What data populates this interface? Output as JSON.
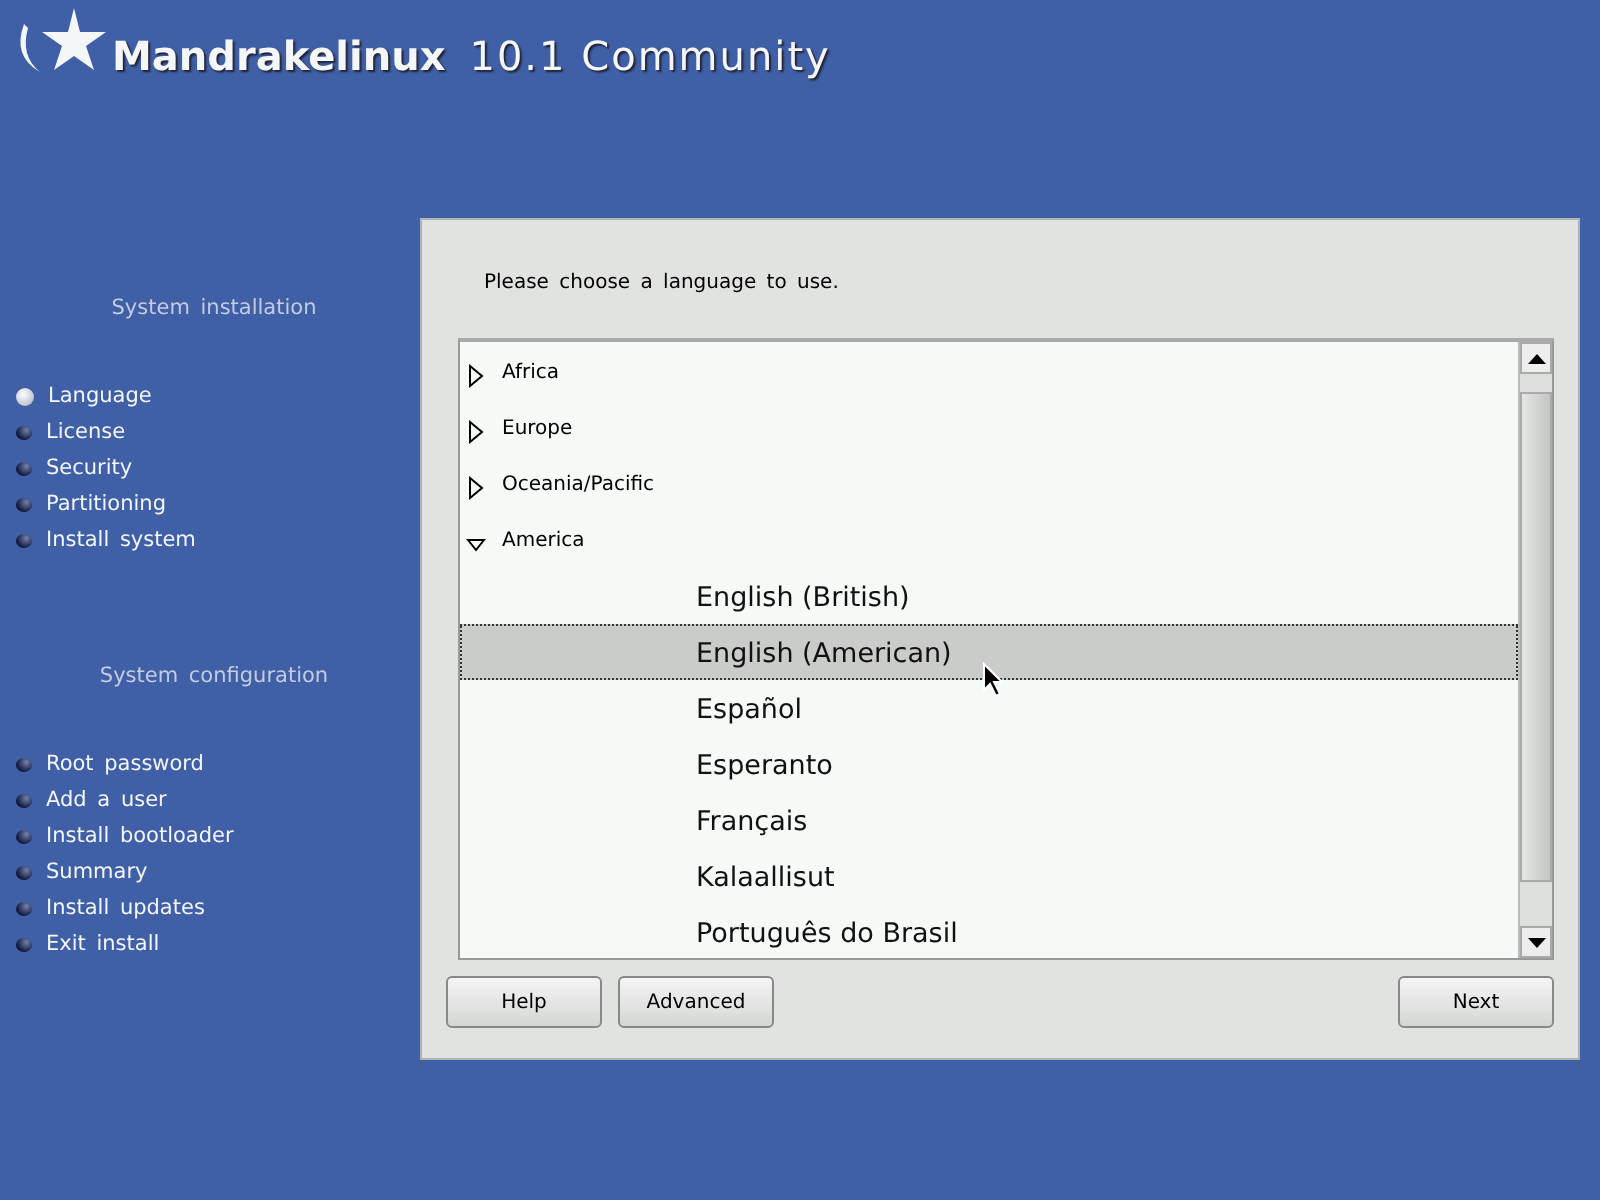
{
  "header": {
    "brand": "Mandrakelinux",
    "version": "10.1 Community"
  },
  "sidebar": {
    "sections": [
      {
        "title": "System installation",
        "items": [
          {
            "label": "Language",
            "selected": true
          },
          {
            "label": "License",
            "selected": false
          },
          {
            "label": "Security",
            "selected": false
          },
          {
            "label": "Partitioning",
            "selected": false
          },
          {
            "label": "Install system",
            "selected": false
          }
        ]
      },
      {
        "title": "System configuration",
        "items": [
          {
            "label": "Root password",
            "selected": false
          },
          {
            "label": "Add a user",
            "selected": false
          },
          {
            "label": "Install bootloader",
            "selected": false
          },
          {
            "label": "Summary",
            "selected": false
          },
          {
            "label": "Install updates",
            "selected": false
          },
          {
            "label": "Exit install",
            "selected": false
          }
        ]
      }
    ]
  },
  "prompt": "Please choose a language to use.",
  "tree": [
    {
      "label": "Africa",
      "expanded": false
    },
    {
      "label": "Europe",
      "expanded": false
    },
    {
      "label": "Oceania/Pacific",
      "expanded": false
    },
    {
      "label": "America",
      "expanded": true,
      "children": [
        {
          "label": "English (British)",
          "selected": false
        },
        {
          "label": "English (American)",
          "selected": true
        },
        {
          "label": "Español",
          "selected": false
        },
        {
          "label": "Esperanto",
          "selected": false
        },
        {
          "label": "Français",
          "selected": false
        },
        {
          "label": "Kalaallisut",
          "selected": false
        },
        {
          "label": "Português do Brasil",
          "selected": false
        }
      ]
    }
  ],
  "buttons": {
    "left": [
      "Help",
      "Advanced"
    ],
    "right": [
      "Next"
    ]
  }
}
